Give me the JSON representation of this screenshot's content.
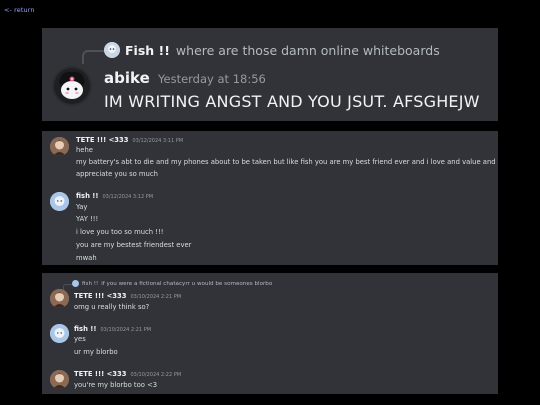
{
  "page": {
    "return_label": "<- return"
  },
  "shot1": {
    "reply": {
      "name": "Fish !!",
      "text": "where are those damn online whiteboards"
    },
    "message": {
      "author": "abike",
      "timestamp": "Yesterday at 18:56",
      "text": "IM WRITING ANGST AND YOU JSUT. AFSGHEJW"
    }
  },
  "shot2": {
    "messages": [
      {
        "author": "TETE !!! <333",
        "timestamp": "03/12/2024 3:11 PM",
        "lines": [
          "hehe",
          "my battery's abt to die and my phones about to be taken but like fish you are my best friend ever and i love and value and",
          "appreciate you so much"
        ]
      },
      {
        "author": "fish !!",
        "timestamp": "03/12/2024 3:12 PM",
        "lines": [
          "Yay",
          "YAY !!!",
          "i love you too so much !!!",
          "you are my bestest friendest ever",
          "mwah"
        ]
      }
    ]
  },
  "shot3": {
    "reply": {
      "name": "fish !!",
      "text": "if you were a fictional chatacyrr u would be someones blorbo"
    },
    "messages": [
      {
        "author": "TETE !!! <333",
        "timestamp": "03/10/2024 2:21 PM",
        "lines": [
          "omg u really think so?"
        ]
      },
      {
        "author": "fish !!",
        "timestamp": "03/10/2024 2:21 PM",
        "lines": [
          "yes",
          "ur my blorbo"
        ]
      },
      {
        "author": "TETE !!! <333",
        "timestamp": "03/10/2024 2:22 PM",
        "lines": [
          "you're my blorbo too <3"
        ]
      }
    ]
  }
}
